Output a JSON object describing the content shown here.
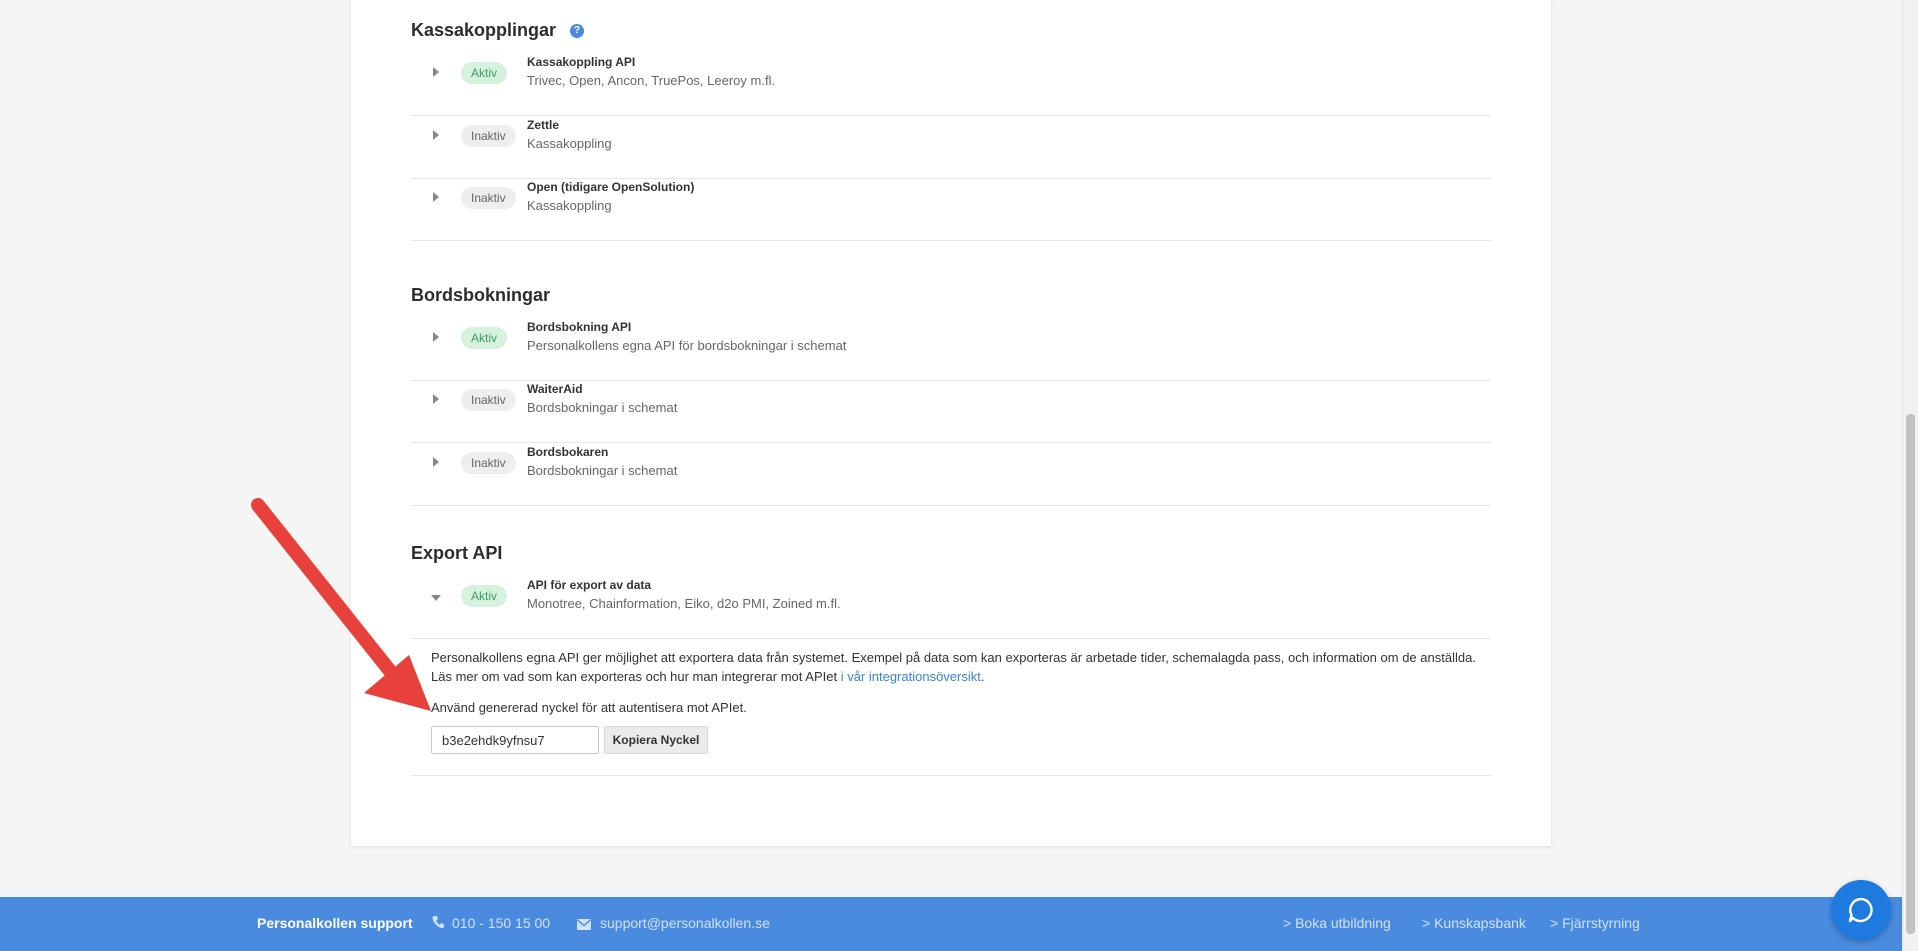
{
  "sections": {
    "kassa": {
      "title": "Kassakopplingar",
      "items": [
        {
          "status": "Aktiv",
          "title": "Kassakoppling API",
          "subtitle": "Trivec, Open, Ancon, TruePos, Leeroy m.fl."
        },
        {
          "status": "Inaktiv",
          "title": "Zettle",
          "subtitle": "Kassakoppling"
        },
        {
          "status": "Inaktiv",
          "title": "Open (tidigare OpenSolution)",
          "subtitle": "Kassakoppling"
        }
      ]
    },
    "bord": {
      "title": "Bordsbokningar",
      "items": [
        {
          "status": "Aktiv",
          "title": "Bordsbokning API",
          "subtitle": "Personalkollens egna API för bordsbokningar i schemat"
        },
        {
          "status": "Inaktiv",
          "title": "WaiterAid",
          "subtitle": "Bordsbokningar i schemat"
        },
        {
          "status": "Inaktiv",
          "title": "Bordsbokaren",
          "subtitle": "Bordsbokningar i schemat"
        }
      ]
    },
    "export": {
      "title": "Export API",
      "items": [
        {
          "status": "Aktiv",
          "title": "API för export av data",
          "subtitle": "Monotree, Chainformation, Eiko, d2o PMI, Zoined m.fl."
        }
      ],
      "description_line1": "Personalkollens egna API ger möjlighet att exportera data från systemet. Exempel på data som kan exporteras är arbetade tider, schemalagda pass, och information om de anställda.",
      "description_line2": "Läs mer om vad som kan exporteras och hur man integrerar mot APIet ",
      "link_text": "i vår integrationsöversikt",
      "link_suffix": ".",
      "key_instruction": "Använd genererad nyckel för att autentisera mot APIet.",
      "key_value": "b3e2ehdk9yfnsu7",
      "copy_button": "Kopiera Nyckel"
    }
  },
  "footer": {
    "title": "Personalkollen support",
    "phone": "010 - 150 15 00",
    "email": "support@personalkollen.se",
    "links": [
      "> Boka utbildning",
      "> Kunskapsbank",
      "> Fjärrstyrning"
    ]
  },
  "colors": {
    "accent": "#4a8be0",
    "active_badge_bg": "#d7f1df",
    "active_badge_text": "#3a9d5d",
    "annotation_arrow": "#e8413c"
  },
  "icons": [
    "help-icon",
    "expand-caret-icon",
    "phone-icon",
    "mail-icon",
    "chat-bubble-icon"
  ]
}
